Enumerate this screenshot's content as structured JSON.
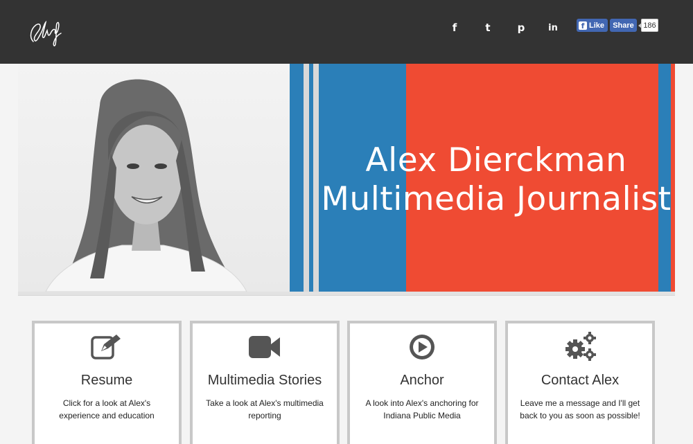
{
  "header": {
    "logo_text": "Alex",
    "social_icons": [
      {
        "name": "facebook-icon",
        "glyph": "f"
      },
      {
        "name": "twitter-icon",
        "glyph": "t"
      },
      {
        "name": "pinterest-icon",
        "glyph": "p"
      },
      {
        "name": "linkedin-icon",
        "glyph": "in"
      }
    ],
    "fb_like_label": "Like",
    "fb_share_label": "Share",
    "fb_share_count": "186"
  },
  "hero": {
    "name": "Alex Dierckman",
    "tagline": "Multimedia Journalist",
    "colors": {
      "blue": "#2b7fb8",
      "red": "#ef4b33",
      "grey": "#9e9e9e"
    }
  },
  "cards": [
    {
      "icon": "edit-icon",
      "title": "Resume",
      "description": "Click for a look at Alex's experience and education"
    },
    {
      "icon": "video-camera-icon",
      "title": "Multimedia Stories",
      "description": "Take a look at Alex's multimedia reporting"
    },
    {
      "icon": "play-icon",
      "title": "Anchor",
      "description": "A look into Alex's anchoring for Indiana Public Media"
    },
    {
      "icon": "gears-icon",
      "title": "Contact Alex",
      "description": "Leave me a message and I'll get back to you as soon as possible!"
    }
  ]
}
